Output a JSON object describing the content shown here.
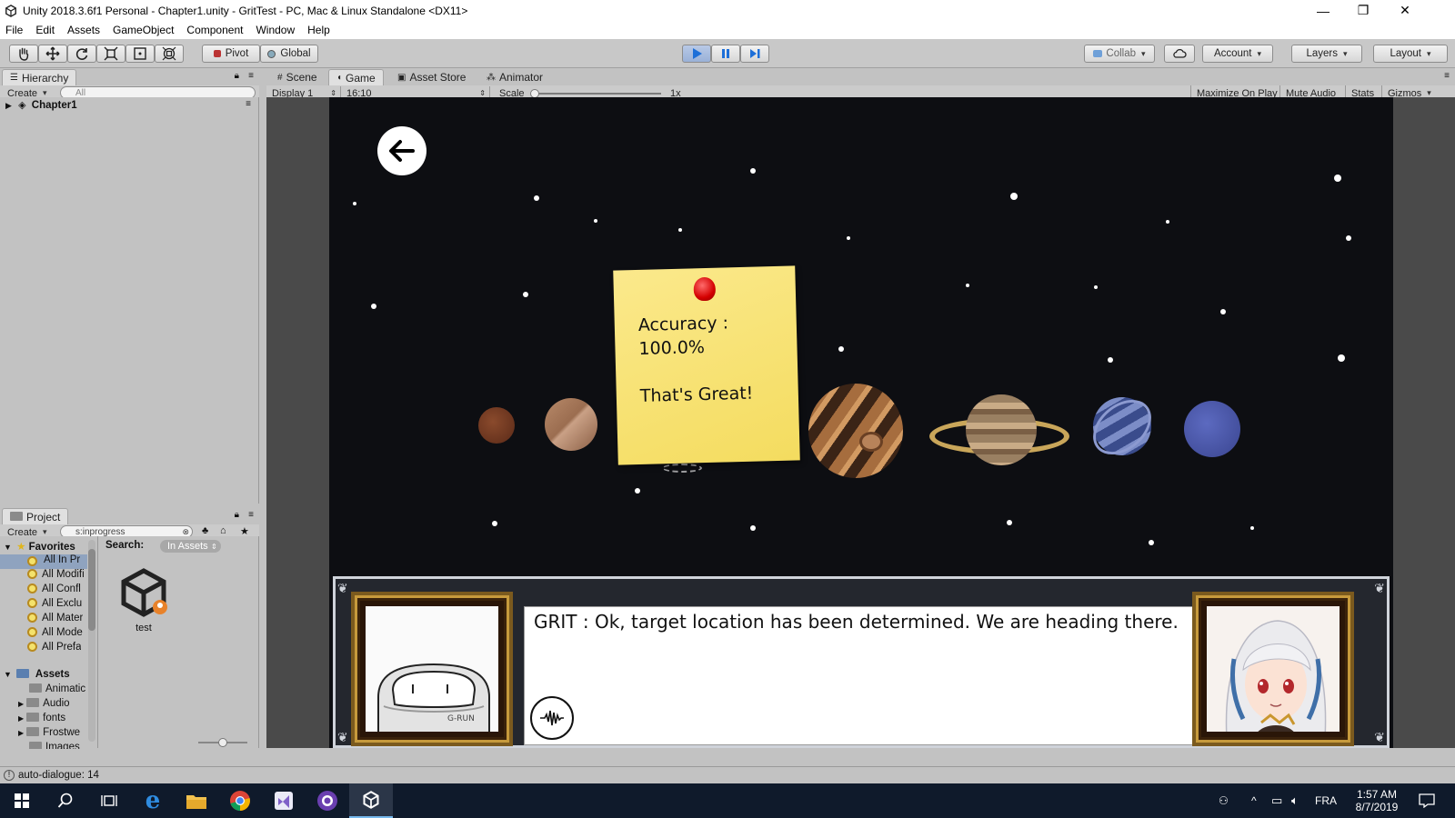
{
  "window": {
    "title": "Unity 2018.3.6f1 Personal - Chapter1.unity - GritTest - PC, Mac & Linux Standalone <DX11>",
    "minimize": "—",
    "maximize": "❐",
    "close": "✕"
  },
  "menu": [
    "File",
    "Edit",
    "Assets",
    "GameObject",
    "Component",
    "Window",
    "Help"
  ],
  "toolbar": {
    "pivot": "Pivot",
    "global": "Global",
    "collab": "Collab",
    "account": "Account",
    "layers": "Layers",
    "layout": "Layout",
    "play_active": true
  },
  "hierarchy": {
    "tab": "Hierarchy",
    "create": "Create",
    "search_placeholder": "All",
    "scene": "Chapter1"
  },
  "view_tabs": [
    "Scene",
    "Game",
    "Asset Store",
    "Animator"
  ],
  "game_bar": {
    "display": "Display 1",
    "aspect": "16:10",
    "scale_label": "Scale",
    "scale_value": "1x",
    "maximize": "Maximize On Play",
    "mute": "Mute Audio",
    "stats": "Stats",
    "gizmos": "Gizmos"
  },
  "project": {
    "tab": "Project",
    "create": "Create",
    "search_value": "s:inprogress",
    "search_label": "Search:",
    "search_scope": "In Assets",
    "favorites_label": "Favorites",
    "favorites": [
      "All In Pr",
      "All Modifi",
      "All Confl",
      "All Exclu",
      "All Mater",
      "All Mode",
      "All Prefa"
    ],
    "assets_label": "Assets",
    "assets": [
      "Animatic",
      "Audio",
      "fonts",
      "Frostwe",
      "Images"
    ],
    "result_item": "test"
  },
  "game": {
    "note_line1": "Accuracy :",
    "note_line2": "100.0%",
    "note_line3": "That's Great!",
    "dialogue": "GRIT : Ok, target location has been determined. We are heading there.",
    "robot_label": "G-RUN"
  },
  "status": {
    "message": "auto-dialogue: 14"
  },
  "taskbar": {
    "language": "FRA",
    "time": "1:57 AM",
    "date": "8/7/2019"
  }
}
